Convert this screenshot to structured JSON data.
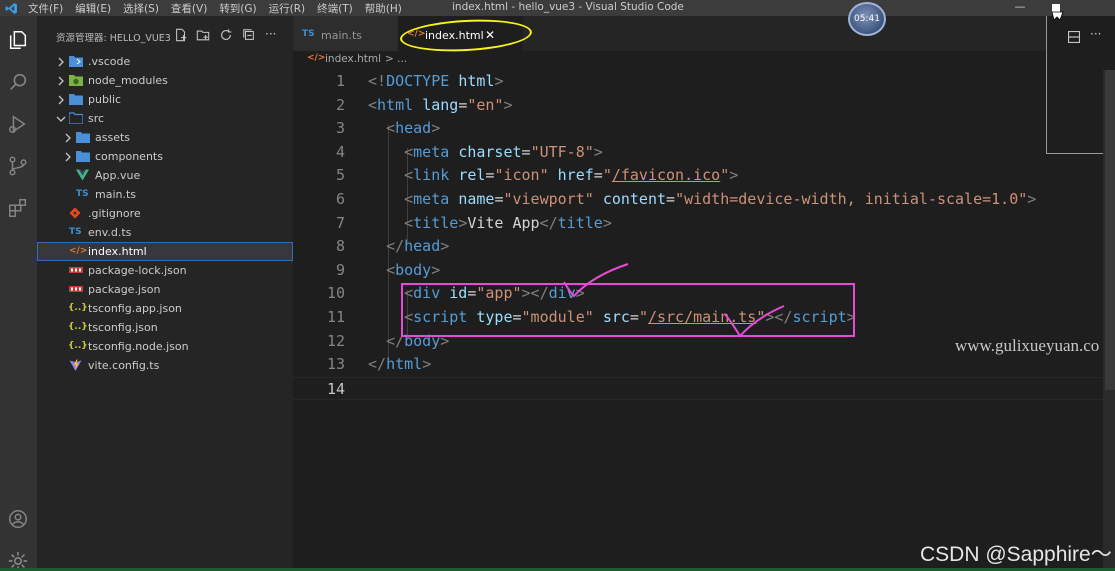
{
  "titlebar": {
    "menu": [
      "文件(F)",
      "编辑(E)",
      "选择(S)",
      "查看(V)",
      "转到(G)",
      "运行(R)",
      "终端(T)",
      "帮助(H)"
    ],
    "window_title": "index.html - hello_vue3 - Visual Studio Code",
    "clock": "05:41"
  },
  "sidebar": {
    "title": "资源管理器: HELLO_VUE3",
    "tree": [
      {
        "label": ".vscode",
        "kind": "folder",
        "state": "collapsed",
        "icon": "vscode-folder-icon"
      },
      {
        "label": "node_modules",
        "kind": "folder",
        "state": "collapsed",
        "icon": "node-modules-folder-icon"
      },
      {
        "label": "public",
        "kind": "folder",
        "state": "collapsed",
        "icon": "folder-icon"
      },
      {
        "label": "src",
        "kind": "folder",
        "state": "expanded",
        "icon": "folder-open-icon"
      },
      {
        "label": "assets",
        "kind": "folder",
        "state": "collapsed",
        "icon": "folder-icon"
      },
      {
        "label": "components",
        "kind": "folder",
        "state": "collapsed",
        "icon": "folder-icon"
      },
      {
        "label": "App.vue",
        "kind": "file",
        "icon": "vue-icon"
      },
      {
        "label": "main.ts",
        "kind": "file",
        "icon": "ts-icon"
      },
      {
        "label": ".gitignore",
        "kind": "file",
        "icon": "git-icon"
      },
      {
        "label": "env.d.ts",
        "kind": "file",
        "icon": "ts-icon"
      },
      {
        "label": "index.html",
        "kind": "file",
        "icon": "html-icon",
        "selected": true
      },
      {
        "label": "package-lock.json",
        "kind": "file",
        "icon": "npm-icon"
      },
      {
        "label": "package.json",
        "kind": "file",
        "icon": "npm-icon"
      },
      {
        "label": "tsconfig.app.json",
        "kind": "file",
        "icon": "json-icon"
      },
      {
        "label": "tsconfig.json",
        "kind": "file",
        "icon": "json-icon"
      },
      {
        "label": "tsconfig.node.json",
        "kind": "file",
        "icon": "json-icon"
      },
      {
        "label": "vite.config.ts",
        "kind": "file",
        "icon": "vite-icon"
      }
    ]
  },
  "editor": {
    "tabs": [
      {
        "label": "main.ts",
        "icon_text": "TS",
        "active": false
      },
      {
        "label": "index.html",
        "icon_text": "</>",
        "active": true
      }
    ],
    "breadcrumb": {
      "file": "index.html",
      "suffix": "> ..."
    },
    "line_numbers": [
      "1",
      "2",
      "3",
      "4",
      "5",
      "6",
      "7",
      "8",
      "9",
      "10",
      "11",
      "12",
      "13",
      "14"
    ],
    "current_line": "14"
  },
  "watermarks": {
    "site": "www.gulixueyuan.co",
    "csdn": "CSDN @Sapphire～"
  },
  "colors": {
    "tag": "#569cd6",
    "attribute": "#9cdcfe",
    "string": "#ce9178",
    "annotation_box": "#e64bd6",
    "annotation_ring": "#f5f51c"
  }
}
